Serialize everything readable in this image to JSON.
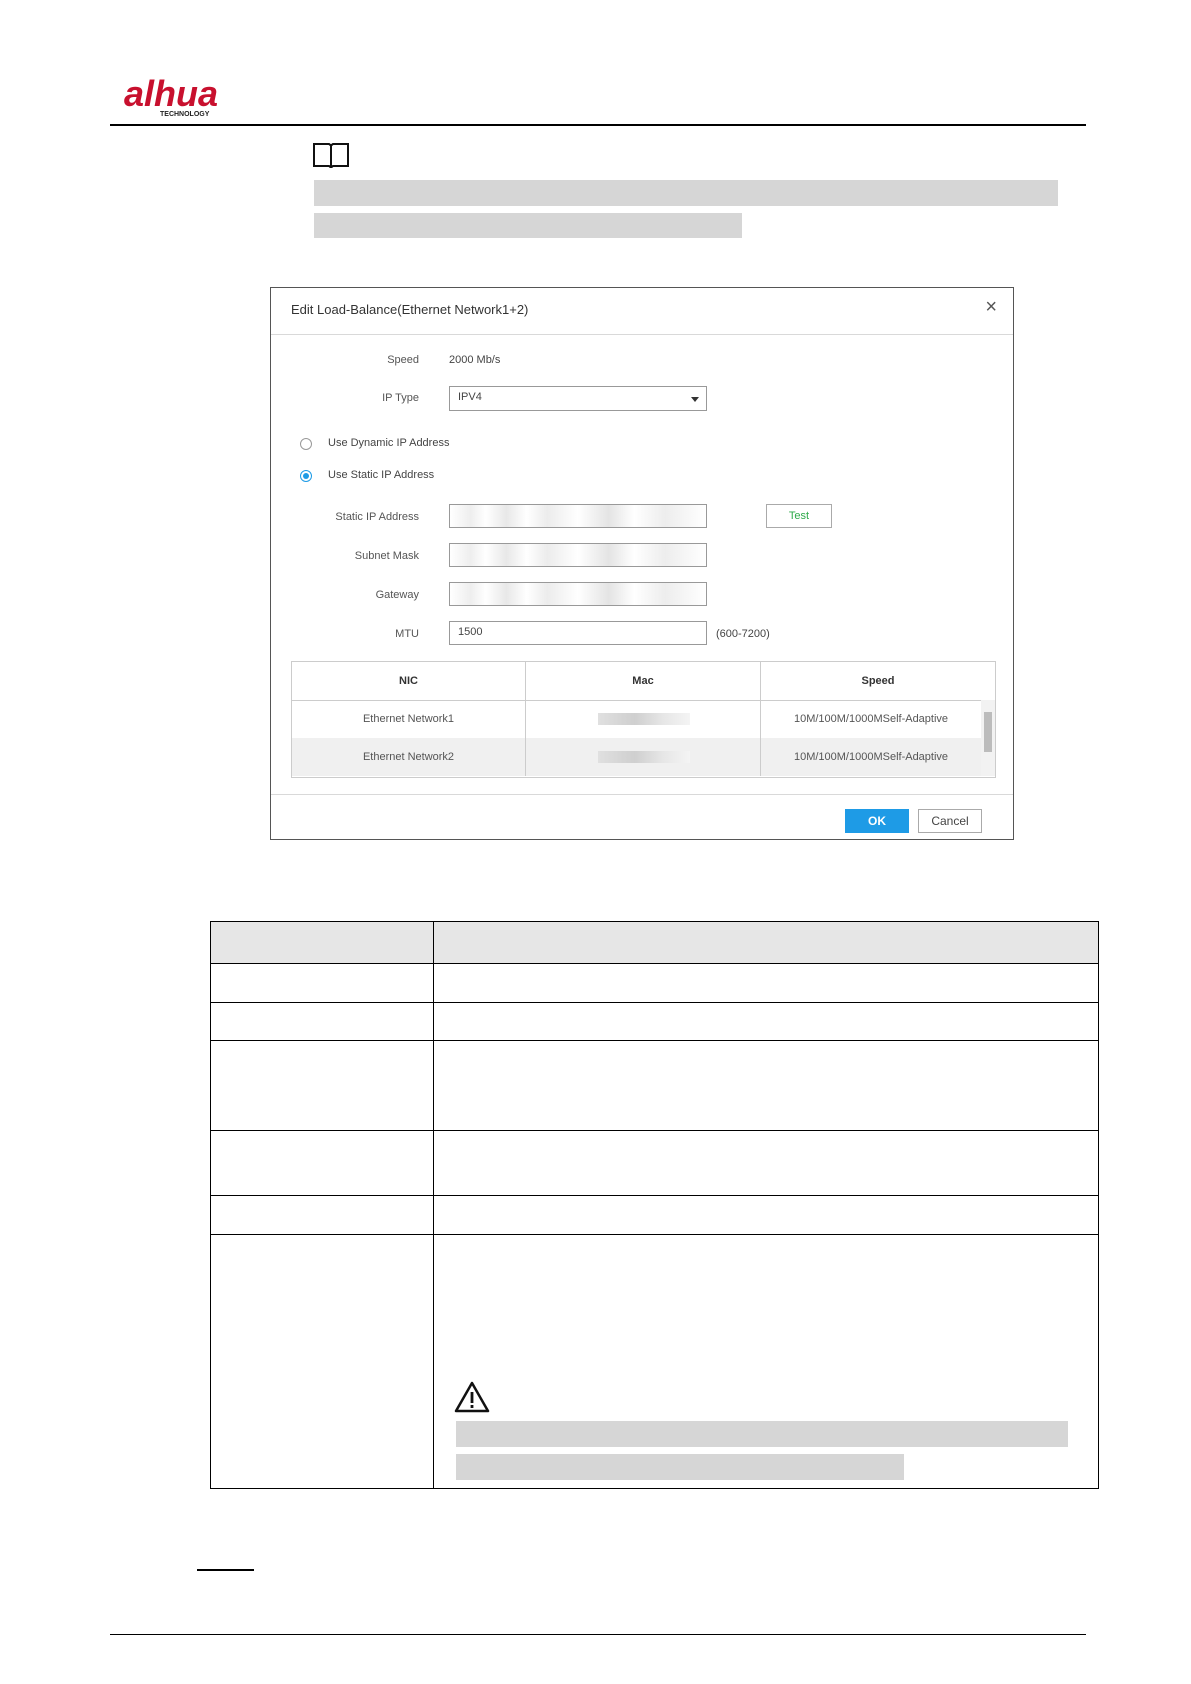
{
  "header": {
    "logo_text": "alhua",
    "logo_subtext": "TECHNOLOGY"
  },
  "icons": {
    "note": "book-icon",
    "warning": "warning-triangle-icon",
    "close": "close-icon",
    "dropdown": "chevron-down-icon"
  },
  "dialog": {
    "title": "Edit Load-Balance(Ethernet Network1+2)",
    "close_label": "×",
    "speed_label": "Speed",
    "speed_value": "2000 Mb/s",
    "ip_type_label": "IP Type",
    "ip_type_value": "IPV4",
    "dynamic_ip_label": "Use Dynamic IP Address",
    "static_ip_label": "Use Static IP Address",
    "selected_mode": "static",
    "static_ip_label_field": "Static IP Address",
    "subnet_mask_label": "Subnet Mask",
    "gateway_label": "Gateway",
    "mtu_label": "MTU",
    "mtu_value": "1500",
    "mtu_range": "(600-7200)",
    "test_button": "Test",
    "table": {
      "headers": [
        "NIC",
        "Mac",
        "Speed"
      ],
      "rows": [
        {
          "nic": "Ethernet Network1",
          "speed": "10M/100M/1000MSelf-Adaptive"
        },
        {
          "nic": "Ethernet Network2",
          "speed": "10M/100M/1000MSelf-Adaptive"
        }
      ]
    },
    "ok_button": "OK",
    "cancel_button": "Cancel"
  },
  "colors": {
    "accent": "#1e9be6",
    "test_text": "#2eaa4a",
    "redaction": "#d6d6d6"
  }
}
